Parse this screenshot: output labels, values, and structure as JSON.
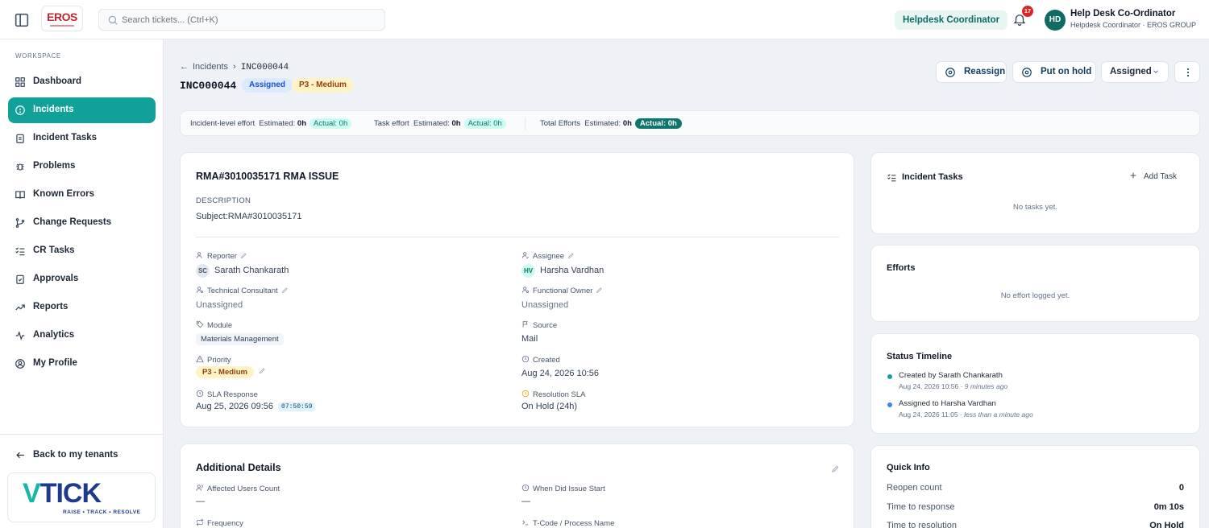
{
  "topbar": {
    "logo_text": "EROS",
    "search_placeholder": "Search tickets... (Ctrl+K)",
    "role_chip": "Helpdesk Coordinator",
    "notification_count": "17",
    "avatar_initials": "HD",
    "user_name": "Help Desk Co-Ordinator",
    "user_subtitle": "Helpdesk Coordinator · EROS GROUP"
  },
  "sidebar": {
    "section_label": "WORKSPACE",
    "items": [
      {
        "label": "Dashboard",
        "icon": "dashboard-icon"
      },
      {
        "label": "Incidents",
        "icon": "alert-circle-icon",
        "active": true
      },
      {
        "label": "Incident Tasks",
        "icon": "clipboard-icon"
      },
      {
        "label": "Problems",
        "icon": "bug-icon"
      },
      {
        "label": "Known Errors",
        "icon": "book-icon"
      },
      {
        "label": "Change Requests",
        "icon": "git-branch-icon"
      },
      {
        "label": "CR Tasks",
        "icon": "list-checks-icon"
      },
      {
        "label": "Approvals",
        "icon": "clipboard-check-icon"
      },
      {
        "label": "Reports",
        "icon": "trending-up-icon"
      },
      {
        "label": "Analytics",
        "icon": "activity-icon"
      },
      {
        "label": "My Profile",
        "icon": "user-circle-icon"
      }
    ],
    "back_label": "Back to my tenants",
    "brand_text": "TICK",
    "brand_v": "V",
    "brand_tagline": "RAISE • TRACK • RESOLVE"
  },
  "header": {
    "breadcrumb_parent": "Incidents",
    "breadcrumb_current": "INC000044",
    "incident_id": "INC000044",
    "status_pill": "Assigned",
    "priority_pill": "P3 - Medium",
    "reassign_label": "Reassign",
    "hold_label": "Put on hold",
    "status_select": "Assigned"
  },
  "efforts_bar": {
    "incident_label": "Incident-level effort",
    "incident_estimated": "Estimated:",
    "incident_estimated_val": "0h",
    "incident_actual": "Actual: 0h",
    "task_label": "Task effort",
    "task_estimated": "Estimated:",
    "task_estimated_val": "0h",
    "task_actual": "Actual: 0h",
    "total_label": "Total Efforts",
    "total_estimated": "Estimated:",
    "total_estimated_val": "0h",
    "total_actual": "Actual: 0h"
  },
  "incident": {
    "title": "RMA#3010035171 RMA ISSUE",
    "description_label": "DESCRIPTION",
    "description": "Subject:RMA#3010035171",
    "reporter_label": "Reporter",
    "reporter_initials": "SC",
    "reporter": "Sarath Chankarath",
    "assignee_label": "Assignee",
    "assignee_initials": "HV",
    "assignee": "Harsha Vardhan",
    "tech_label": "Technical Consultant",
    "tech_value": "Unassigned",
    "func_label": "Functional Owner",
    "func_value": "Unassigned",
    "module_label": "Module",
    "module_value": "Materials Management",
    "source_label": "Source",
    "source_value": "Mail",
    "priority_label": "Priority",
    "priority_value": "P3 - Medium",
    "created_label": "Created",
    "created_value": "Aug 24, 2026 10:56",
    "sla_label": "SLA Response",
    "sla_value": "Aug 25, 2026 09:56",
    "sla_timer": "07:50:59",
    "res_sla_label": "Resolution SLA",
    "res_sla_value": "On Hold (24h)"
  },
  "additional": {
    "title": "Additional Details",
    "affected_label": "Affected Users Count",
    "affected_value": "—",
    "start_label": "When Did Issue Start",
    "start_value": "—",
    "frequency_label": "Frequency",
    "tcode_label": "T-Code / Process Name"
  },
  "tasks_panel": {
    "title": "Incident Tasks",
    "add_label": "Add Task",
    "empty": "No tasks yet."
  },
  "efforts_panel": {
    "title": "Efforts",
    "empty": "No effort logged yet."
  },
  "timeline": {
    "title": "Status Timeline",
    "entries": [
      {
        "text": "Created by Sarath Chankarath",
        "date": "Aug 24, 2026 10:56 · ",
        "ago": "9 minutes ago",
        "color": "#12a199"
      },
      {
        "text": "Assigned to Harsha Vardhan",
        "date": "Aug 24, 2026 11:05 · ",
        "ago": "less than a minute ago",
        "color": "#3b82f6"
      }
    ]
  },
  "quick_info": {
    "title": "Quick Info",
    "rows": [
      {
        "label": "Reopen count",
        "value": "0"
      },
      {
        "label": "Time to response",
        "value": "0m 10s"
      },
      {
        "label": "Time to resolution",
        "value": "On Hold"
      }
    ]
  }
}
